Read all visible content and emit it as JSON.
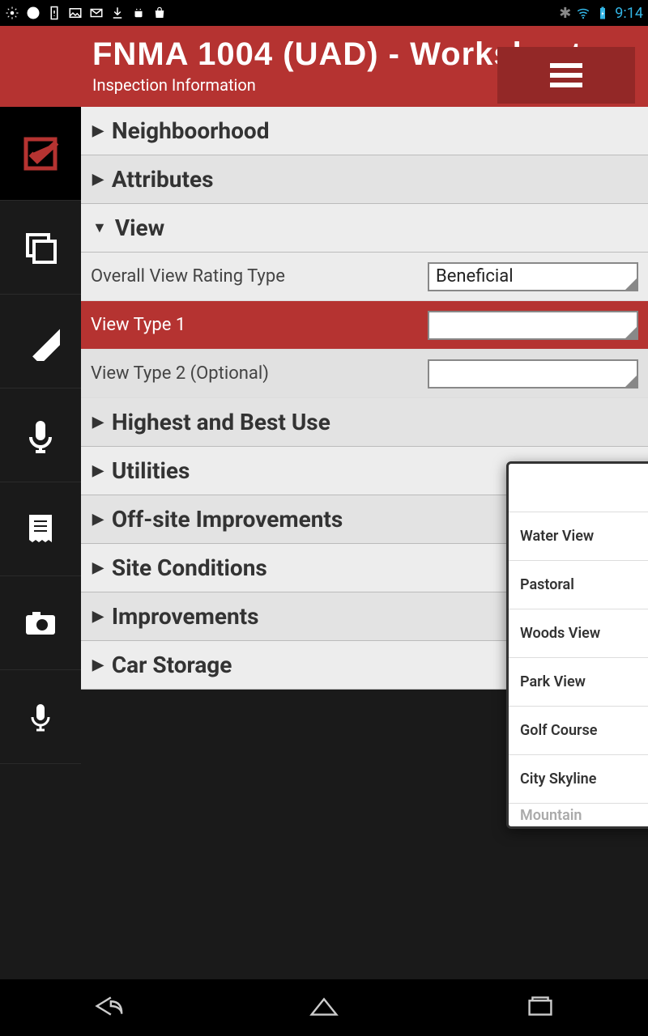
{
  "statusbar": {
    "time": "9:14"
  },
  "header": {
    "title": "FNMA 1004 (UAD) - Worksheet",
    "subtitle": "Inspection Information"
  },
  "sections": [
    {
      "label": "Neighboorhood",
      "expanded": false,
      "alt": false
    },
    {
      "label": "Attributes",
      "expanded": false,
      "alt": true
    },
    {
      "label": "View",
      "expanded": true,
      "alt": false
    },
    {
      "label": "Highest and Best Use",
      "expanded": false,
      "alt": true
    },
    {
      "label": "Utilities",
      "expanded": false,
      "alt": false
    },
    {
      "label": "Off-site Improvements",
      "expanded": false,
      "alt": true
    },
    {
      "label": "Site Conditions",
      "expanded": false,
      "alt": false
    },
    {
      "label": "Improvements",
      "expanded": false,
      "alt": true
    },
    {
      "label": "Car Storage",
      "expanded": false,
      "alt": false
    }
  ],
  "view_fields": {
    "overall": {
      "label": "Overall View Rating Type",
      "value": "Beneficial"
    },
    "type1": {
      "label": "View Type 1",
      "value": ""
    },
    "type2": {
      "label": "View Type 2 (Optional)",
      "value": ""
    }
  },
  "popup_options": [
    "",
    "Water View",
    "Pastoral",
    "Woods View",
    "Park View",
    "Golf Course",
    "City Skyline",
    "Mountain"
  ]
}
